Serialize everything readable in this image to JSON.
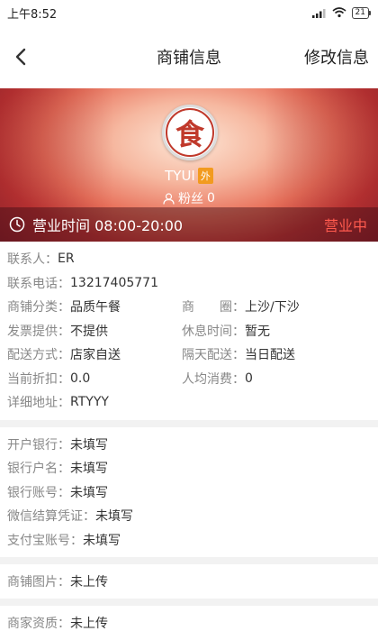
{
  "status_bar": {
    "time": "上午8:52",
    "battery": "21"
  },
  "nav": {
    "title": "商铺信息",
    "edit": "修改信息"
  },
  "shop": {
    "logo_char": "食",
    "name": "TYUI",
    "tag": "外",
    "fans_label": "粉丝",
    "fans_count": "0",
    "hours": "营业时间 08:00-20:00",
    "status": "营业中"
  },
  "info": {
    "contact": {
      "label": "联系人：",
      "value": "ER"
    },
    "phone": {
      "label": "联系电话：",
      "value": "13217405771"
    },
    "category": {
      "label": "商铺分类：",
      "value": "品质午餐"
    },
    "district": {
      "label": "商　　圈：",
      "value": "上沙/下沙"
    },
    "invoice": {
      "label": "发票提供：",
      "value": "不提供"
    },
    "rest_time": {
      "label": "休息时间：",
      "value": "暂无"
    },
    "delivery_method": {
      "label": "配送方式：",
      "value": "店家自送"
    },
    "next_day": {
      "label": "隔天配送：",
      "value": "当日配送"
    },
    "discount": {
      "label": "当前折扣：",
      "value": "0.0"
    },
    "avg_spend": {
      "label": "人均消费：",
      "value": "0"
    },
    "address": {
      "label": "详细地址：",
      "value": "RTYYY"
    }
  },
  "bank": {
    "bank_name": {
      "label": "开户银行：",
      "value": "未填写"
    },
    "account_name": {
      "label": "银行户名：",
      "value": "未填写"
    },
    "account_no": {
      "label": "银行账号：",
      "value": "未填写"
    },
    "wechat": {
      "label": "微信结算凭证：",
      "value": "未填写"
    },
    "alipay": {
      "label": "支付宝账号：",
      "value": "未填写"
    }
  },
  "images": {
    "label": "商铺图片：",
    "value": "未上传"
  },
  "qualification": {
    "label": "商家资质：",
    "value": "未上传"
  }
}
